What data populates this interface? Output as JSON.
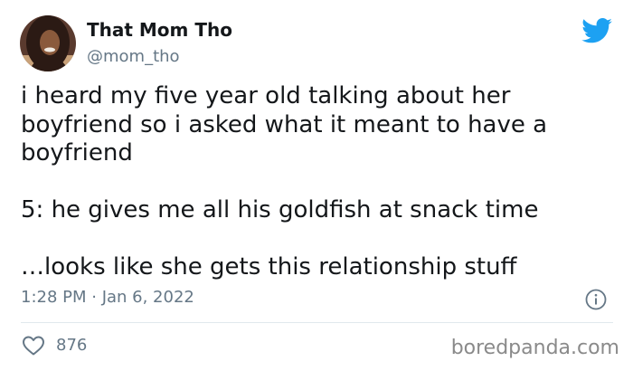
{
  "author": {
    "name": "That Mom Tho",
    "handle": "@mom_tho",
    "avatar_icon": "profile-photo"
  },
  "tweet": {
    "paragraphs": [
      "i heard my five year old talking about her\nboyfriend so i asked what it meant to have a\nboyfriend",
      "5: he gives me all his goldfish at snack time",
      "…looks like she gets this relationship stuff"
    ],
    "timestamp": "1:28 PM · Jan 6, 2022"
  },
  "engagement": {
    "likes": "876",
    "like_icon": "heart-icon",
    "info_icon": "info-icon"
  },
  "brand": {
    "twitter_icon": "twitter-bird-icon",
    "twitter_color": "#1da1f2"
  },
  "watermark": {
    "text": "boredpanda.com"
  }
}
